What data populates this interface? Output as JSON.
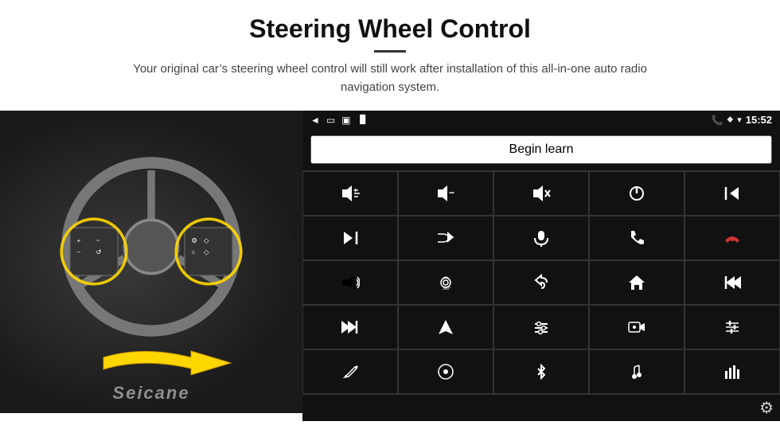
{
  "header": {
    "title": "Steering Wheel Control",
    "subtitle": "Your original car’s steering wheel control will still work after installation of this all-in-one auto radio navigation system."
  },
  "status_bar": {
    "back_icon": "◄",
    "home_icon": "□",
    "recent_icon": "■",
    "signal_icon": "▐░",
    "phone_icon": "☎",
    "location_icon": "▲",
    "wifi_icon": "▼",
    "time": "15:52"
  },
  "begin_learn_label": "Begin learn",
  "icons": [
    {
      "id": "vol-up",
      "symbol": "🔊+"
    },
    {
      "id": "vol-down",
      "symbol": "🔉–"
    },
    {
      "id": "vol-mute",
      "symbol": "🔇"
    },
    {
      "id": "power",
      "symbol": "⏻"
    },
    {
      "id": "prev-track",
      "symbol": "⏮"
    },
    {
      "id": "skip-next",
      "symbol": "⏭"
    },
    {
      "id": "shuffle",
      "symbol": "⇆⏭"
    },
    {
      "id": "mic",
      "symbol": "🎤"
    },
    {
      "id": "phone",
      "symbol": "📞"
    },
    {
      "id": "hang-up",
      "symbol": "↘"
    },
    {
      "id": "horn",
      "symbol": "📢"
    },
    {
      "id": "camera-360",
      "symbol": "📷"
    },
    {
      "id": "back",
      "symbol": "↺"
    },
    {
      "id": "home",
      "symbol": "⌂"
    },
    {
      "id": "skip-back",
      "symbol": "⏮⏮"
    },
    {
      "id": "fast-forward",
      "symbol": "⏩⏩"
    },
    {
      "id": "navigate",
      "symbol": "➤"
    },
    {
      "id": "eq",
      "symbol": "≡↓"
    },
    {
      "id": "camera-rec",
      "symbol": "📹"
    },
    {
      "id": "equalizer",
      "symbol": "⦀"
    },
    {
      "id": "pen",
      "symbol": "✏"
    },
    {
      "id": "circle-dot",
      "symbol": "◎"
    },
    {
      "id": "bluetooth",
      "symbol": "в"
    },
    {
      "id": "music",
      "symbol": "♫"
    },
    {
      "id": "bars",
      "symbol": "⦀⦀"
    }
  ],
  "gear_icon": "⚙",
  "seicane_text": "Seicane",
  "colors": {
    "panel_bg": "#111111",
    "cell_border": "#333333",
    "button_bg": "#ffffff",
    "text_color": "#ffffff",
    "yellow": "#FFD700"
  }
}
